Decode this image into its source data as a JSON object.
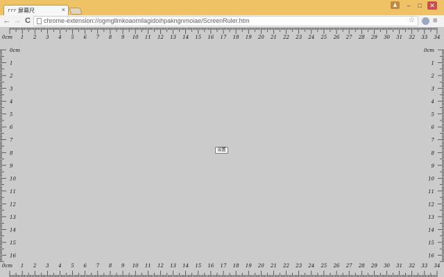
{
  "browser": {
    "tab_icon": "rrr",
    "tab_title": "屏幕尺",
    "tab_close": "×",
    "profile_label": "♟",
    "minimize": "–",
    "maximize": "□",
    "close": "✕",
    "back": "←",
    "forward": "→",
    "reload": "C",
    "url": "chrome-extension://ogmgllmkoaomilagidoihpakngnmoiae/ScreenRuler.htm",
    "bookmark": "☆",
    "menu": "≡"
  },
  "ruler": {
    "unit": "cm",
    "horizontal_max": 34,
    "vertical_max": 16,
    "zero_label": "0cm"
  },
  "settings_button_label": "设置",
  "colors": {
    "titlebar": "#f0c266",
    "page_background": "#cbcbcb",
    "ticks": "#111111"
  }
}
